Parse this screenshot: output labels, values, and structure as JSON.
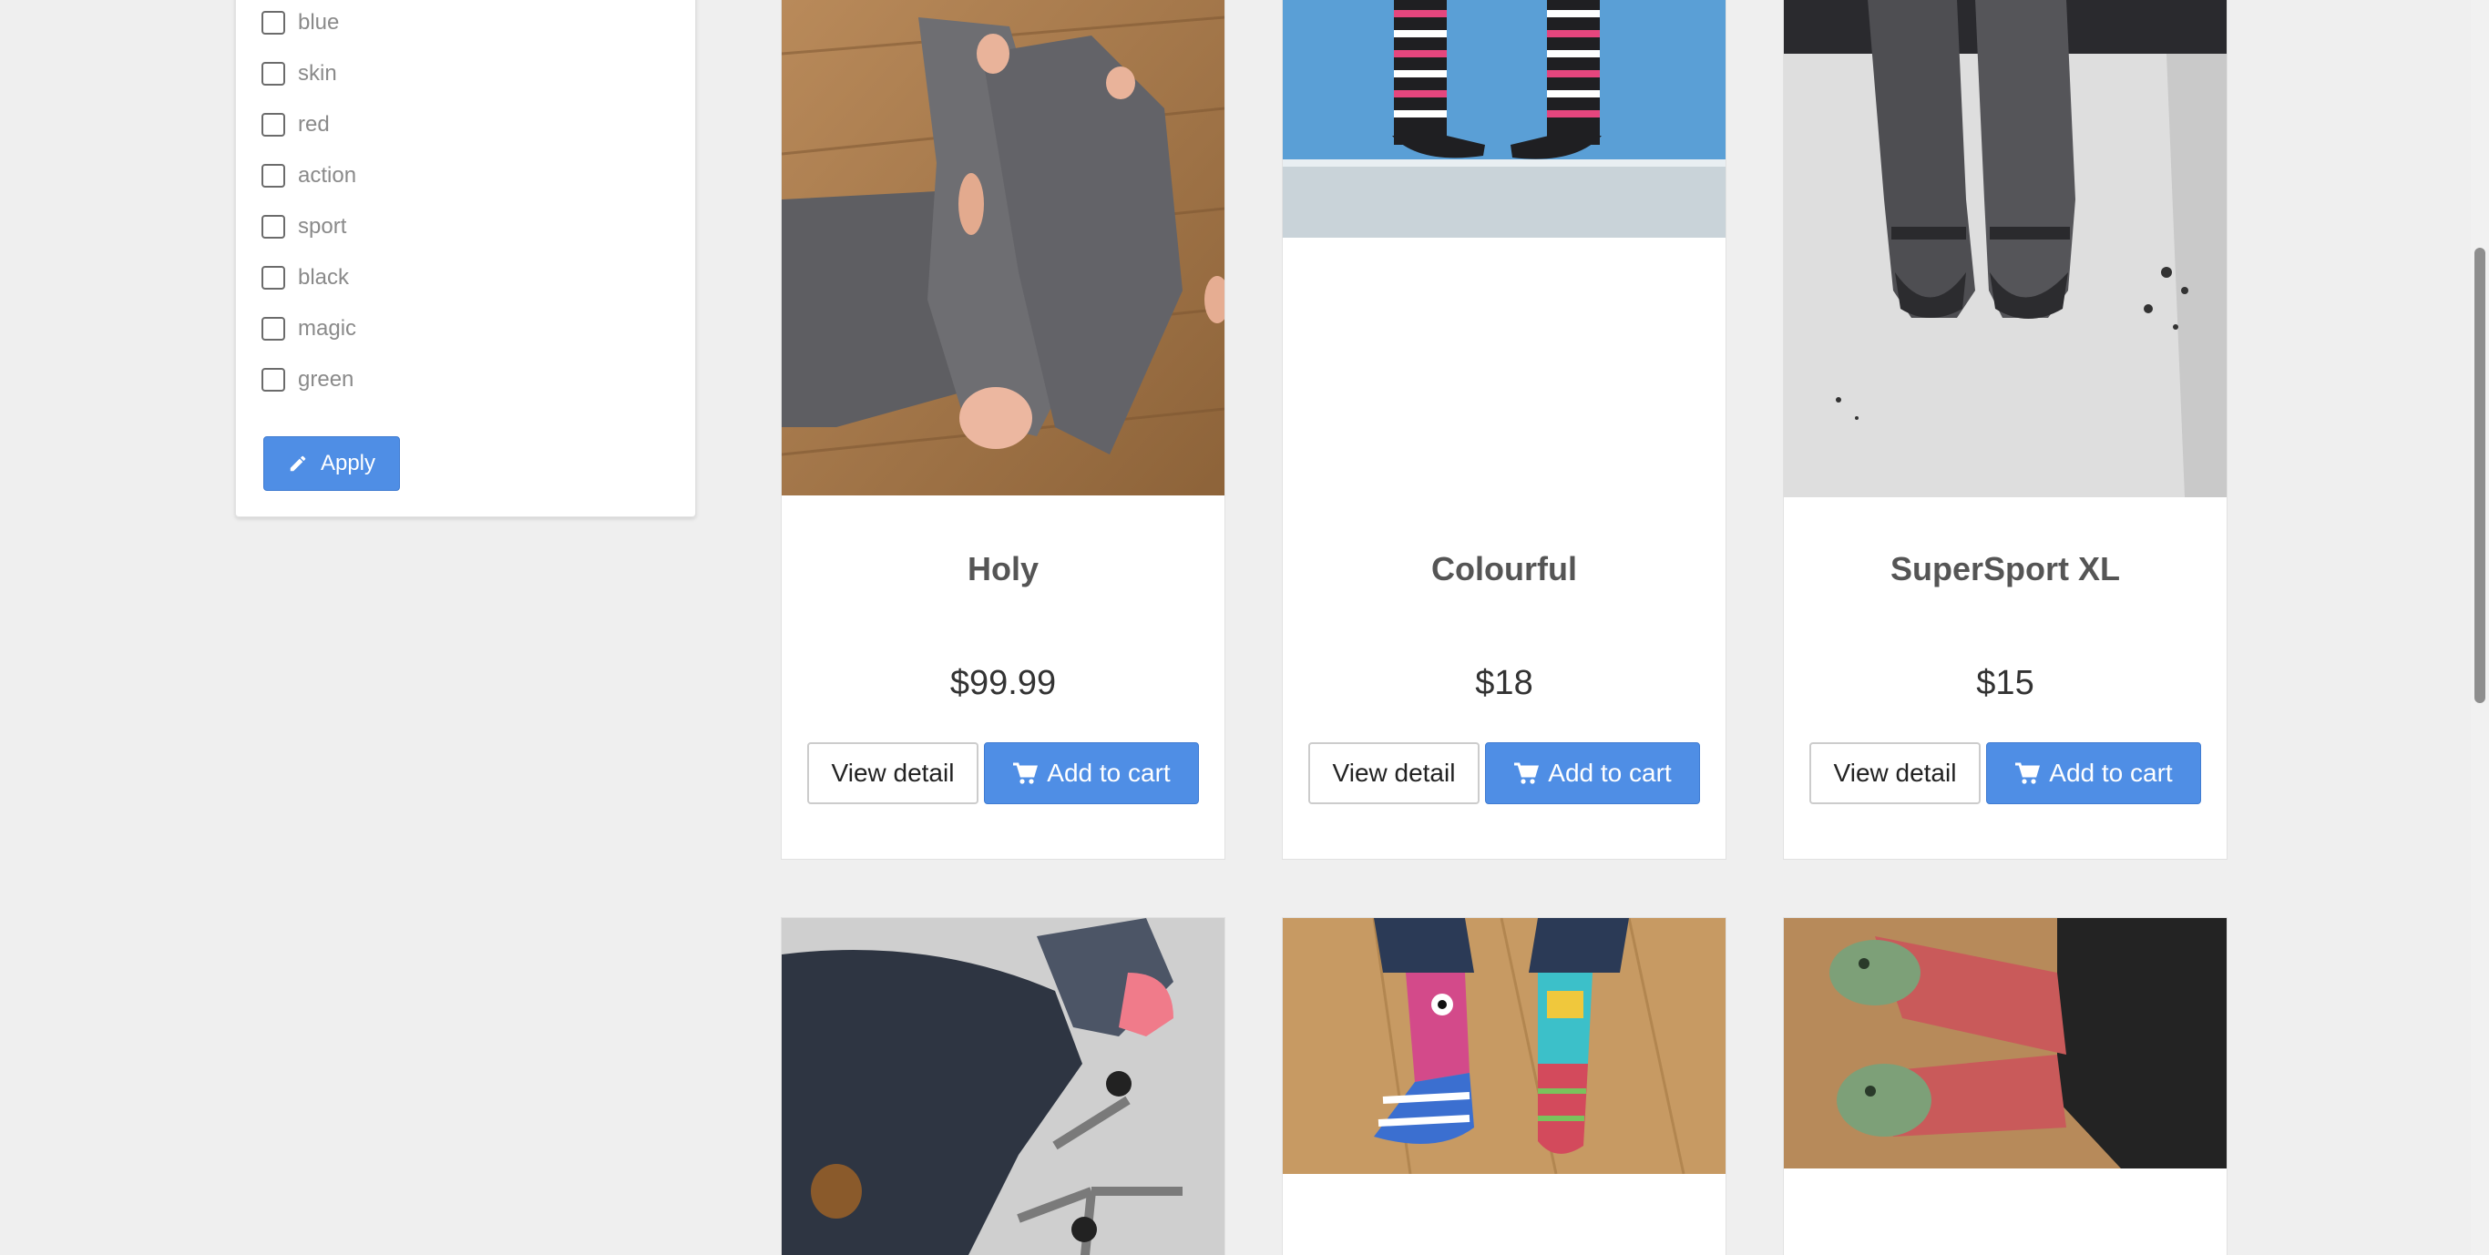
{
  "filters": {
    "tags": [
      "blue",
      "skin",
      "red",
      "action",
      "sport",
      "black",
      "magic",
      "green"
    ],
    "apply_label": "Apply"
  },
  "products": [
    {
      "name": "Holy",
      "price": "$99.99",
      "detail_label": "View detail",
      "cart_label": "Add to cart",
      "image": "torn-grey-socks-photo"
    },
    {
      "name": "Colourful",
      "price": "$18",
      "detail_label": "View detail",
      "cart_label": "Add to cart",
      "image": "striped-socks-photo"
    },
    {
      "name": "SuperSport XL",
      "price": "$15",
      "detail_label": "View detail",
      "cart_label": "Add to cart",
      "image": "grey-sport-socks-photo"
    }
  ],
  "next_row_images": [
    "space-socks-photo",
    "monster-socks-photo",
    "dinosaur-socks-photo"
  ],
  "colors": {
    "accent": "#4f8ee5",
    "background": "#efefef"
  }
}
